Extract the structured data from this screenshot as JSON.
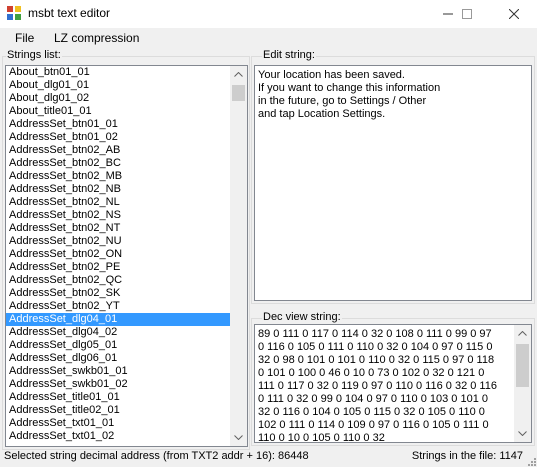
{
  "window": {
    "title": "msbt text editor",
    "controls": {
      "minimize": "—",
      "maximize": "☐",
      "close": "✕"
    }
  },
  "menu": [
    {
      "label": "File"
    },
    {
      "label": "LZ compression"
    }
  ],
  "strings_panel": {
    "label": "Strings list:",
    "items": [
      "About_btn01_01",
      "About_dlg01_01",
      "About_dlg01_02",
      "About_title01_01",
      "AddressSet_btn01_01",
      "AddressSet_btn01_02",
      "AddressSet_btn02_AB",
      "AddressSet_btn02_BC",
      "AddressSet_btn02_MB",
      "AddressSet_btn02_NB",
      "AddressSet_btn02_NL",
      "AddressSet_btn02_NS",
      "AddressSet_btn02_NT",
      "AddressSet_btn02_NU",
      "AddressSet_btn02_ON",
      "AddressSet_btn02_PE",
      "AddressSet_btn02_QC",
      "AddressSet_btn02_SK",
      "AddressSet_btn02_YT",
      "AddressSet_dlg04_01",
      "AddressSet_dlg04_02",
      "AddressSet_dlg05_01",
      "AddressSet_dlg06_01",
      "AddressSet_swkb01_01",
      "AddressSet_swkb01_02",
      "AddressSet_title01_01",
      "AddressSet_title02_01",
      "AddressSet_txt01_01",
      "AddressSet_txt01_02"
    ],
    "selected_index": 19
  },
  "edit_panel": {
    "label": "Edit string:",
    "text": "Your location has been saved.\nIf you want to change this information\nin the future, go to Settings / Other\nand tap Location Settings."
  },
  "dec_panel": {
    "label": "Dec view string:",
    "text": "89 0 111 0 117 0 114 0 32 0 108 0 111 0 99 0 97 0 116 0 105 0 111 0 110 0 32 0 104 0 97 0 115 0 32 0 98 0 101 0 101 0 110 0 32 0 115 0 97 0 118 0 101 0 100 0 46 0 10 0 73 0 102 0 32 0 121 0 111 0 117 0 32 0 119 0 97 0 110 0 116 0 32 0 116 0 111 0 32 0 99 0 104 0 97 0 110 0 103 0 101 0 32 0 116 0 104 0 105 0 115 0 32 0 105 0 110 0 102 0 111 0 114 0 109 0 97 0 116 0 105 0 111 0 110 0 10 0 105 0 110 0 32"
  },
  "status": {
    "address_text": "Selected string decimal address (from TXT2 addr + 16): 86448",
    "count_text": "Strings in the file: 1147"
  },
  "colors": {
    "selection": "#3399ff",
    "window_bg": "#f0f0f0",
    "border": "#828790"
  }
}
